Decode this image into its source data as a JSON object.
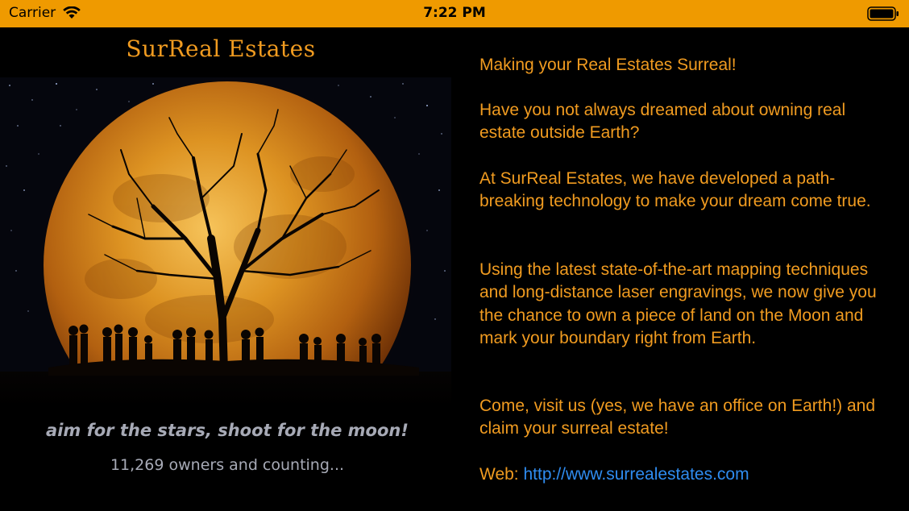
{
  "status_bar": {
    "carrier": "Carrier",
    "time": "7:22 PM",
    "icons": [
      "wifi-icon",
      "battery-icon"
    ]
  },
  "brand": {
    "title": "SurReal Estates"
  },
  "hero_image": {
    "description_icon": "full-moon-tree-silhouette-image"
  },
  "tagline": "aim for the stars, shoot for the moon!",
  "owners_count": "11,269 owners and counting...",
  "content": {
    "lead": "Making your Real Estates Surreal!",
    "paragraph_1": "Have you not always dreamed about owning real estate outside Earth?",
    "paragraph_2": "At SurReal Estates, we have developed a path-breaking technology to make your dream come true.",
    "paragraph_3": "Using the latest state-of-the-art mapping techniques and long-distance laser engravings, we now give you the chance to own a piece of land on the Moon and mark your boundary right from Earth.",
    "paragraph_4": "Come, visit us (yes, we have an office on Earth!) and claim your surreal estate!",
    "web_label": "Web:",
    "web_url": "http://www.surrealestates.com"
  },
  "colors": {
    "accent": "#f09b20",
    "status_bar": "#ef9a00",
    "link": "#2f8cf0",
    "muted_text": "#a7aab6",
    "background": "#000000"
  }
}
